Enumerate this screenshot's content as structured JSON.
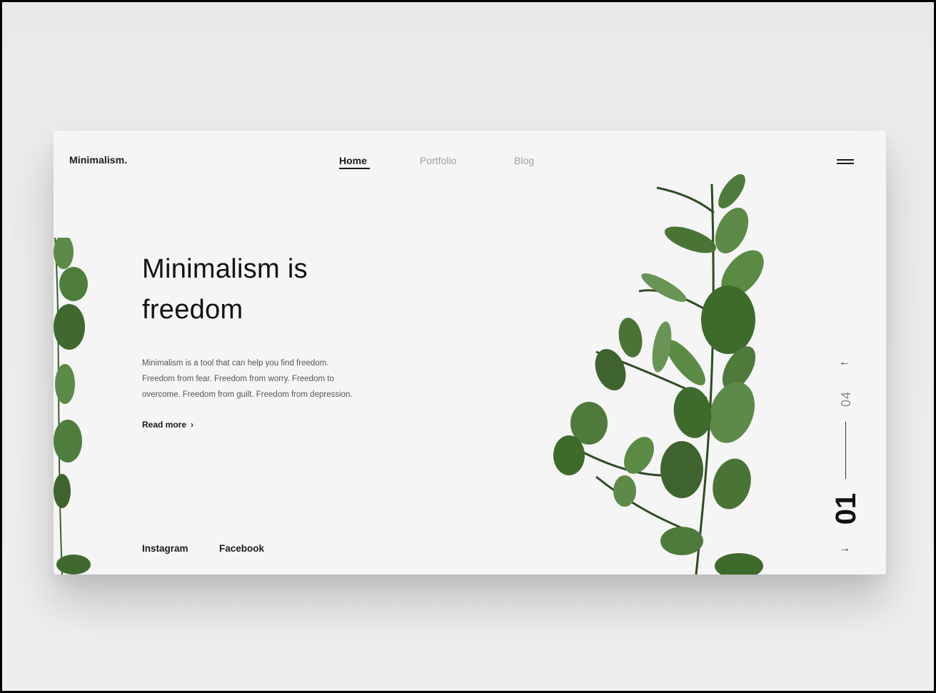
{
  "brand": "Minimalism.",
  "nav": {
    "items": [
      {
        "label": "Home",
        "active": true
      },
      {
        "label": "Portfolio",
        "active": false
      },
      {
        "label": "Blog",
        "active": false
      }
    ]
  },
  "menu_icon": "hamburger-menu-icon",
  "hero": {
    "headline_line1": "Minimalism is",
    "headline_line2": "freedom",
    "paragraph_line1": "Minimalism is a tool that can help you find freedom.",
    "paragraph_line2": "Freedom from fear. Freedom from worry. Freedom to",
    "paragraph_line3": "overcome. Freedom from guilt. Freedom from depression.",
    "read_more": "Read more",
    "read_more_chevron": "›"
  },
  "social": {
    "instagram": "Instagram",
    "facebook": "Facebook"
  },
  "slider": {
    "prev_arrow": "←",
    "next_arrow": "→",
    "total": "04",
    "current": "01"
  },
  "colors": {
    "card_background": "#f5f5f6",
    "text_primary": "#121212",
    "nav_inactive": "#a0a0a0",
    "leaf_green": "#4e7a3c"
  }
}
